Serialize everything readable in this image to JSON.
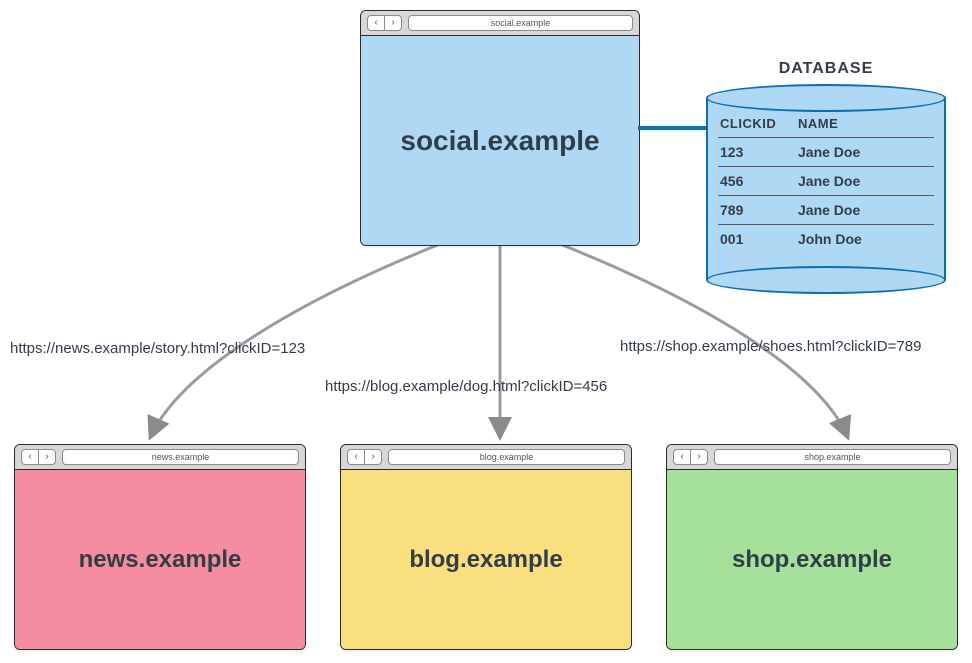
{
  "main": {
    "address": "social.example",
    "title": "social.example",
    "color": "#aed8f4"
  },
  "database": {
    "label": "DATABASE",
    "headers": {
      "c1": "CLICKID",
      "c2": "NAME"
    },
    "rows": [
      {
        "clickid": "123",
        "name": "Jane Doe"
      },
      {
        "clickid": "456",
        "name": "Jane Doe"
      },
      {
        "clickid": "789",
        "name": "Jane Doe"
      },
      {
        "clickid": "001",
        "name": "John Doe"
      }
    ]
  },
  "links": {
    "left": "https://news.example/story.html?clickID=123",
    "center": "https://blog.example/dog.html?clickID=456",
    "right": "https://shop.example/shoes.html?clickID=789"
  },
  "targets": [
    {
      "address": "news.example",
      "title": "news.example",
      "color": "#f58ca0"
    },
    {
      "address": "blog.example",
      "title": "blog.example",
      "color": "#fadf7f"
    },
    {
      "address": "shop.example",
      "title": "shop.example",
      "color": "#a5e19a"
    }
  ]
}
